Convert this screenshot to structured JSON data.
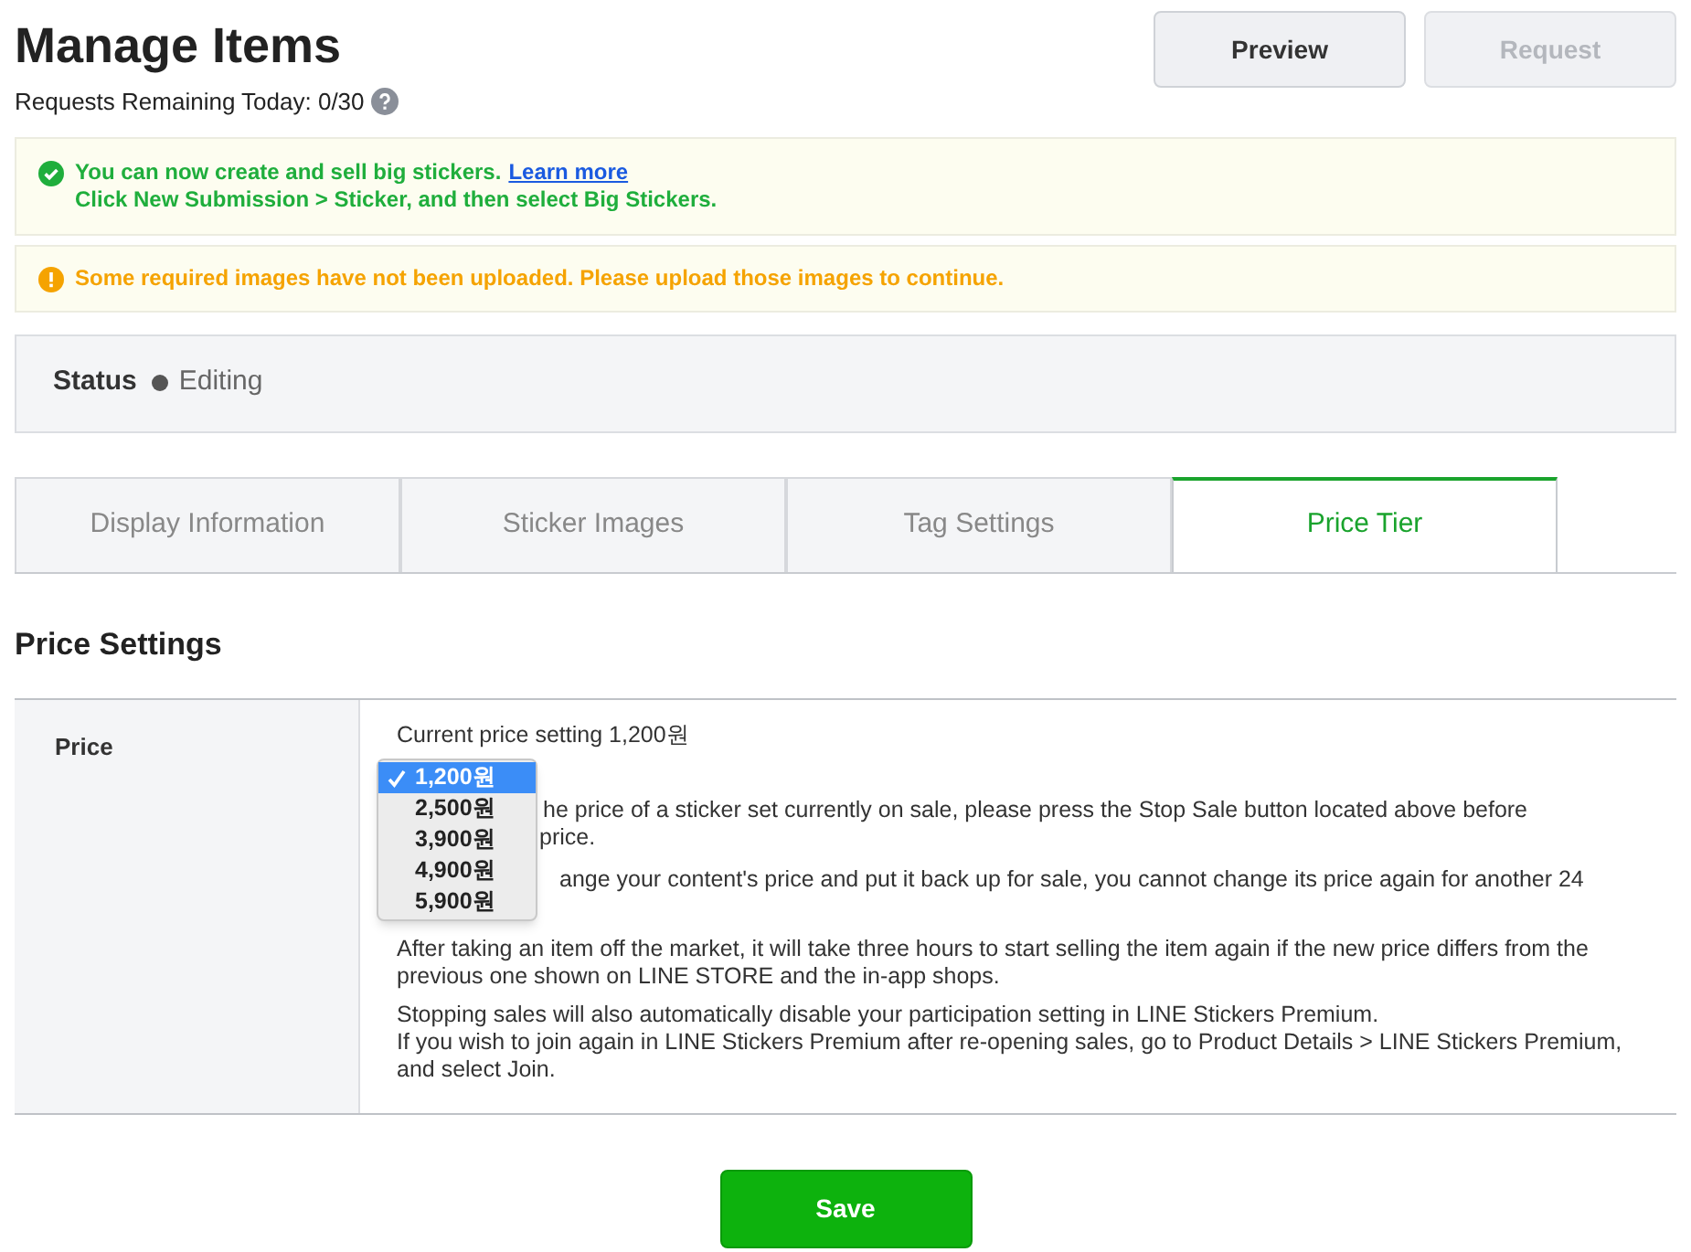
{
  "title": "Manage Items",
  "requests_remaining": "Requests Remaining Today: 0/30",
  "buttons": [
    {
      "label": "Preview",
      "disabled": false
    },
    {
      "label": "Request",
      "disabled": true
    }
  ],
  "notices": [
    {
      "kind": "success",
      "lines": [
        "You can now create and sell big stickers.",
        "Click New Submission > Sticker, and then select Big Stickers."
      ],
      "link": "Learn more"
    },
    {
      "kind": "warning",
      "lines": [
        "Some required images have not been uploaded. Please upload those images to continue."
      ]
    }
  ],
  "status": {
    "label": "Status",
    "value": "Editing"
  },
  "tabs": [
    {
      "label": "Display Information",
      "selected": false
    },
    {
      "label": "Sticker Images",
      "selected": false
    },
    {
      "label": "Tag Settings",
      "selected": false
    },
    {
      "label": "Price Tier",
      "selected": true
    }
  ],
  "section_title": "Price Settings",
  "price_row": {
    "label": "Price",
    "current": "Current price setting 1,200원",
    "dropdown": [
      {
        "label": "1,200원",
        "selected": true
      },
      {
        "label": "2,500원",
        "selected": false
      },
      {
        "label": "3,900원",
        "selected": false
      },
      {
        "label": "4,900원",
        "selected": false
      },
      {
        "label": "5,900원",
        "selected": false
      }
    ],
    "covered_lines": [
      "he price of a sticker set currently on sale, please press the Stop Sale button located above before",
      "price.",
      "ange your content's price and put it back up for sale, you cannot change its price again for another 24"
    ],
    "paragraphs": [
      "After taking an item off the market, it will take three hours to start selling the item again if the new price differs from the previous one shown on LINE STORE and the in-app shops.",
      "Stopping sales will also automatically disable your participation setting in LINE Stickers Premium.\nIf you wish to join again in LINE Stickers Premium after re-opening sales, go to Product Details > LINE Stickers Premium, and select Join."
    ]
  },
  "save": "Save"
}
